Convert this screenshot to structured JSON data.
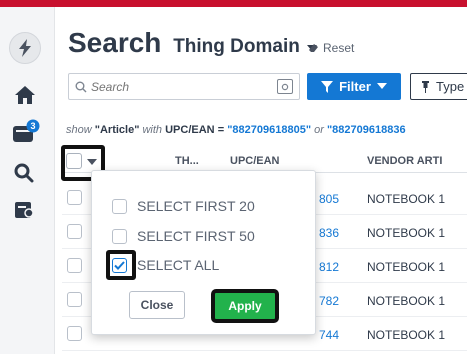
{
  "header": {
    "title": "Search",
    "domain": "Thing Domain",
    "reset_label": "Reset"
  },
  "nav": {
    "notification_count": "3"
  },
  "toolbar": {
    "search_placeholder": "Search",
    "filter_label": "Filter",
    "type_label": "Type"
  },
  "query": {
    "prefix": "show",
    "entity": "\"Article\"",
    "with": "with",
    "field": "UPC/EAN",
    "eq": "=",
    "value1": "\"882709618805\"",
    "or": "or",
    "value2": "\"882709618836"
  },
  "table": {
    "columns": [
      "TH...",
      "UPC/EAN",
      "VENDOR ARTI"
    ],
    "rows": [
      {
        "upc": "805",
        "vendor": "NOTEBOOK 1"
      },
      {
        "upc": "836",
        "vendor": "NOTEBOOK 1"
      },
      {
        "upc": "812",
        "vendor": "NOTEBOOK 1"
      },
      {
        "upc": "782",
        "vendor": "NOTEBOOK 1"
      },
      {
        "upc": "744",
        "vendor": "NOTEBOOK 1"
      }
    ]
  },
  "dropdown": {
    "options": [
      {
        "label": "SELECT FIRST 20",
        "checked": false
      },
      {
        "label": "SELECT FIRST 50",
        "checked": false
      },
      {
        "label": "SELECT ALL",
        "checked": true
      }
    ],
    "close_label": "Close",
    "apply_label": "Apply"
  },
  "colors": {
    "accent": "#1478d4",
    "brand_bar": "#c8102e",
    "apply": "#22b24c",
    "badge": "#1478d4"
  }
}
